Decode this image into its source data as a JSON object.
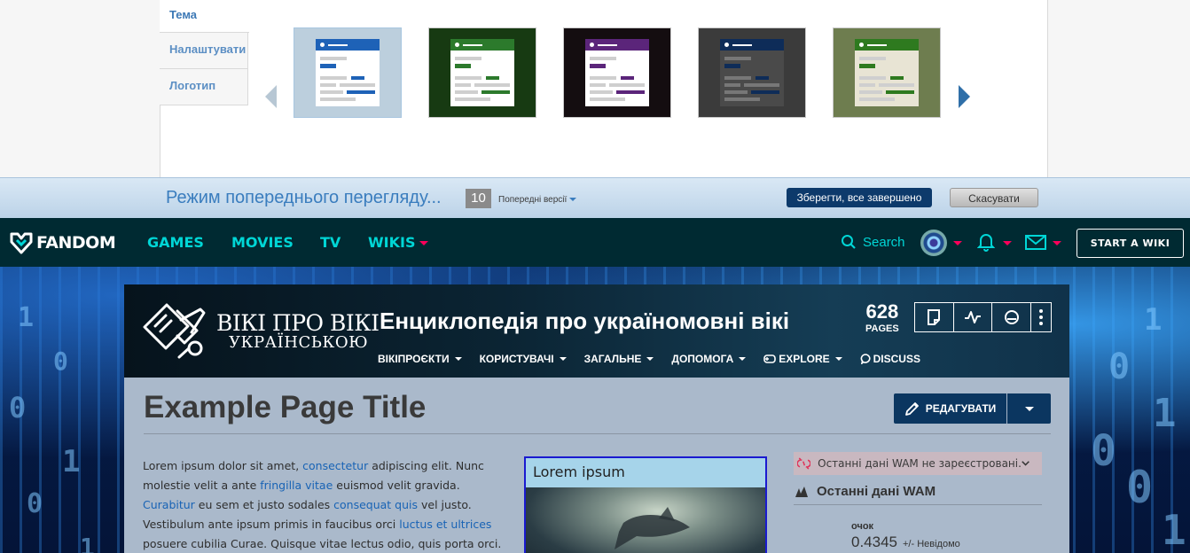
{
  "designer": {
    "tabs": [
      "Тема",
      "Налаштувати",
      "Логотип"
    ],
    "themes": [
      {
        "bg": "#bccfdd",
        "accent": "#1e62b7"
      },
      {
        "bg": "#173a12",
        "accent": "#2c7a2c"
      },
      {
        "bg": "#140d10",
        "accent": "#5b257a"
      },
      {
        "bg": "#3b3b3b",
        "accent": "#0e2c58"
      },
      {
        "bg": "#6e7d4f",
        "accent": "#2e7a1f"
      }
    ]
  },
  "preview": {
    "title": "Режим попереднього перегляду...",
    "revision_count": "10",
    "previous_versions": "Попередні версії",
    "save": "Зберегти, все завершено",
    "cancel": "Скасувати"
  },
  "fandom_nav": {
    "logo": "FANDOM",
    "links": [
      "GAMES",
      "MOVIES",
      "TV",
      "WIKIS"
    ],
    "search": "Search",
    "start_wiki": "START A WIKI",
    "colors": {
      "bg": "#002a32",
      "link": "#00d6d6",
      "caret": "#fa005a"
    }
  },
  "wiki": {
    "wordmark_line1": "ВІКІ ПРО ВІКІ",
    "wordmark_line2": "УКРАЇНСЬКОЮ",
    "sitename": "Енциклопедія про україномовні вікі",
    "pages_count": "628",
    "pages_label": "PAGES",
    "menu": [
      {
        "label": "ВІКІПРОЄКТИ",
        "icon": ""
      },
      {
        "label": "КОРИСТУВАЧІ",
        "icon": ""
      },
      {
        "label": "ЗАГАЛЬНЕ",
        "icon": ""
      },
      {
        "label": "ДОПОМОГА",
        "icon": ""
      },
      {
        "label": "EXPLORE",
        "icon": "gamepad-icon"
      },
      {
        "label": "DISCUSS",
        "icon": "speech-bubble-icon"
      }
    ]
  },
  "article": {
    "title": "Example Page Title",
    "edit": "РЕДАГУВАТИ",
    "body_segments": [
      {
        "t": "Lorem ipsum dolor sit amet, ",
        "link": false
      },
      {
        "t": "consectetur",
        "link": true
      },
      {
        "t": " adipiscing elit. Nunc molestie velit a ante ",
        "link": false
      },
      {
        "t": "fringilla vitae",
        "link": true
      },
      {
        "t": " euismod velit gravida. ",
        "link": false
      },
      {
        "t": "Curabitur",
        "link": true
      },
      {
        "t": " eu sem et justo sodales ",
        "link": false
      },
      {
        "t": "consequat quis",
        "link": true
      },
      {
        "t": " vel justo. Vestibulum ante ipsum primis in faucibus orci ",
        "link": false
      },
      {
        "t": "luctus et ultrices",
        "link": true
      },
      {
        "t": " posuere cubilia Curae. Quisque vitae lectus odio, quis porta orci.",
        "link": false
      }
    ],
    "infobox_title": "Lorem ipsum"
  },
  "rail": {
    "wam_alert": "Останні дані WAM не зареєстровані.",
    "wam_heading": "Останні дані WAM",
    "score_label": "очок",
    "score": "0.4345",
    "delta": "+/- Невідомо"
  }
}
